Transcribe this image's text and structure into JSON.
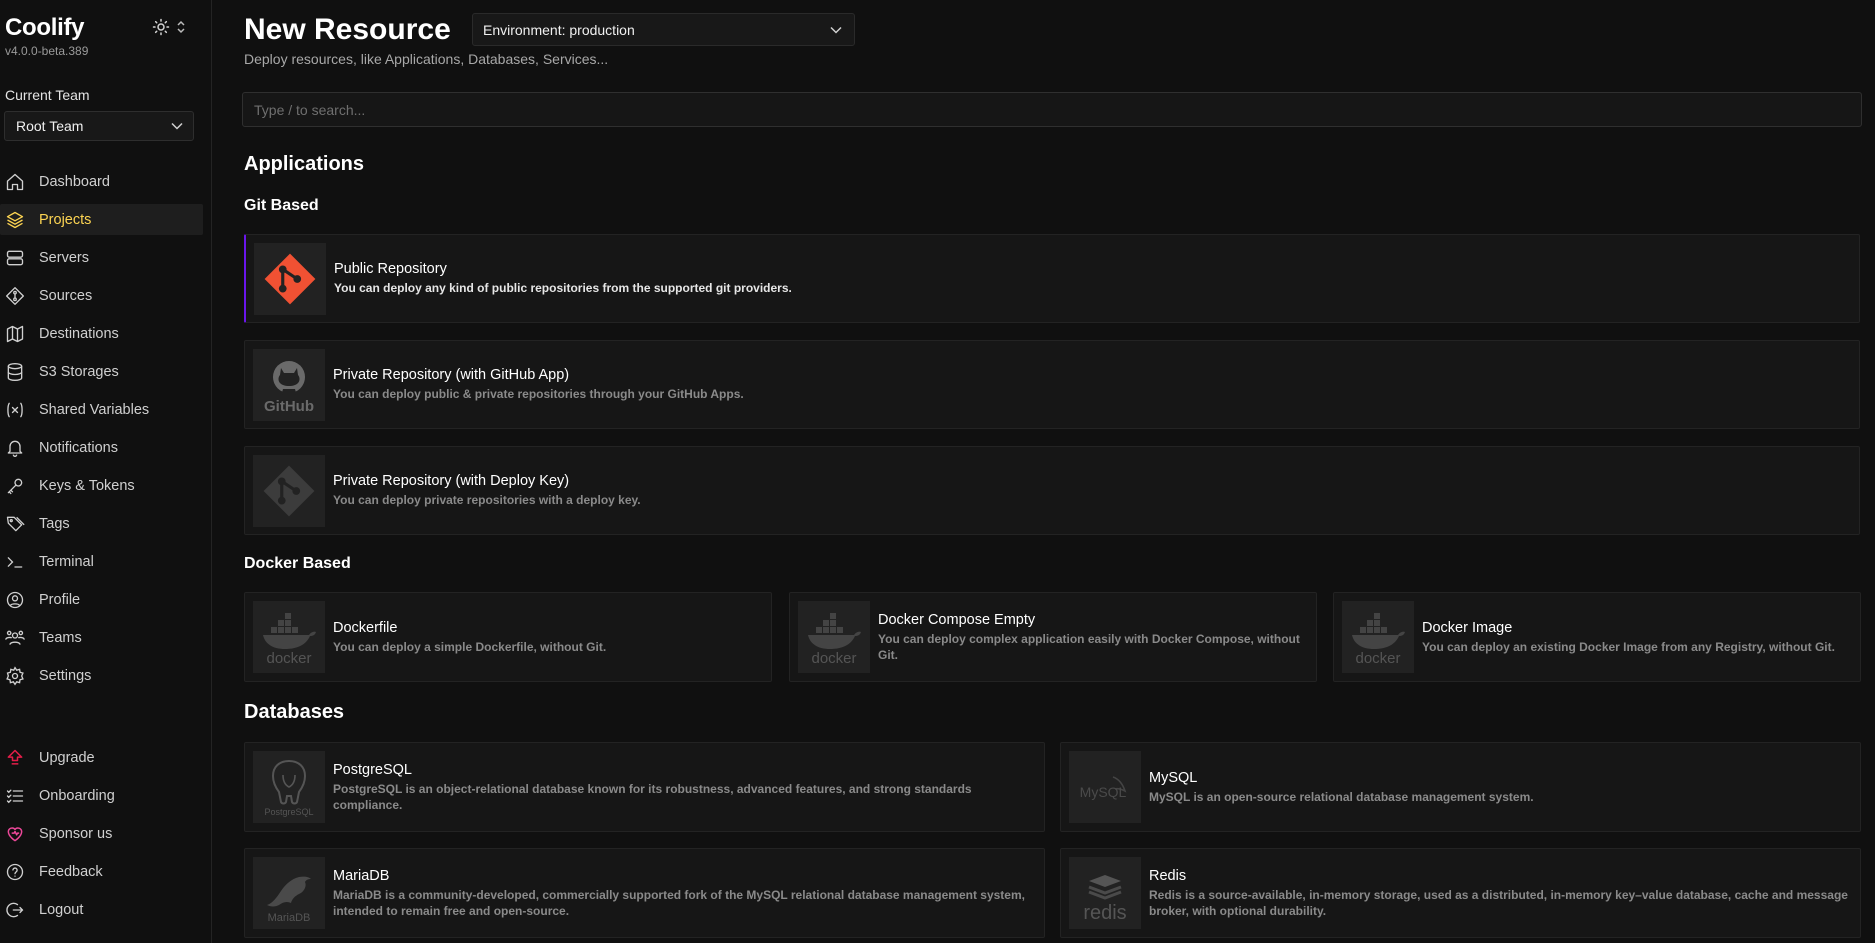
{
  "sidebar": {
    "brand": "Coolify",
    "version": "v4.0.0-beta.389",
    "current_team_label": "Current Team",
    "team": "Root Team",
    "items": [
      {
        "label": "Dashboard",
        "icon": "home-icon"
      },
      {
        "label": "Projects",
        "icon": "layers-icon"
      },
      {
        "label": "Servers",
        "icon": "server-icon"
      },
      {
        "label": "Sources",
        "icon": "git-icon"
      },
      {
        "label": "Destinations",
        "icon": "map-icon"
      },
      {
        "label": "S3 Storages",
        "icon": "database-icon"
      },
      {
        "label": "Shared Variables",
        "icon": "variable-icon"
      },
      {
        "label": "Notifications",
        "icon": "bell-icon"
      },
      {
        "label": "Keys & Tokens",
        "icon": "key-icon"
      },
      {
        "label": "Tags",
        "icon": "tag-icon"
      },
      {
        "label": "Terminal",
        "icon": "terminal-icon"
      },
      {
        "label": "Profile",
        "icon": "user-circle-icon"
      },
      {
        "label": "Teams",
        "icon": "users-icon"
      },
      {
        "label": "Settings",
        "icon": "gear-icon"
      }
    ],
    "bottom_items": [
      {
        "label": "Upgrade",
        "icon": "upgrade-icon"
      },
      {
        "label": "Onboarding",
        "icon": "list-icon"
      },
      {
        "label": "Sponsor us",
        "icon": "heart-icon"
      },
      {
        "label": "Feedback",
        "icon": "help-icon"
      },
      {
        "label": "Logout",
        "icon": "logout-icon"
      }
    ]
  },
  "header": {
    "title": "New Resource",
    "environment": "Environment: production",
    "subtitle": "Deploy resources, like Applications, Databases, Services..."
  },
  "search": {
    "placeholder": "Type / to search..."
  },
  "sections": {
    "applications": "Applications",
    "git_based": "Git Based",
    "docker_based": "Docker Based",
    "databases": "Databases"
  },
  "git_cards": [
    {
      "title": "Public Repository",
      "desc": "You can deploy any kind of public repositories from the supported git providers.",
      "logo": "git-logo-icon"
    },
    {
      "title": "Private Repository (with GitHub App)",
      "desc": "You can deploy public & private repositories through your GitHub Apps.",
      "logo": "github-logo-icon"
    },
    {
      "title": "Private Repository (with Deploy Key)",
      "desc": "You can deploy private repositories with a deploy key.",
      "logo": "git-logo-icon"
    }
  ],
  "docker_cards": [
    {
      "title": "Dockerfile",
      "desc": "You can deploy a simple Dockerfile, without Git.",
      "logo": "docker-logo-icon"
    },
    {
      "title": "Docker Compose Empty",
      "desc": "You can deploy complex application easily with Docker Compose, without Git.",
      "logo": "docker-logo-icon"
    },
    {
      "title": "Docker Image",
      "desc": "You can deploy an existing Docker Image from any Registry, without Git.",
      "logo": "docker-logo-icon"
    }
  ],
  "db_cards": [
    {
      "title": "PostgreSQL",
      "desc": "PostgreSQL is an object-relational database known for its robustness, advanced features, and strong standards compliance.",
      "logo": "postgresql-logo-icon"
    },
    {
      "title": "MySQL",
      "desc": "MySQL is an open-source relational database management system.",
      "logo": "mysql-logo-icon"
    },
    {
      "title": "MariaDB",
      "desc": "MariaDB is a community-developed, commercially supported fork of the MySQL relational database management system, intended to remain free and open-source.",
      "logo": "mariadb-logo-icon"
    },
    {
      "title": "Redis",
      "desc": "Redis is a source-available, in-memory storage, used as a distributed, in-memory key–value database, cache and message broker, with optional durability.",
      "logo": "redis-logo-icon"
    }
  ],
  "logo_text": {
    "github": "GitHub",
    "docker": "docker",
    "postgresql": "PostgreSQL",
    "mysql": "MySQL",
    "mariadb": "MariaDB",
    "redis": "redis"
  },
  "colors": {
    "accent": "#fcd452",
    "highlight": "#6b16ed",
    "git_orange": "#f05133"
  }
}
